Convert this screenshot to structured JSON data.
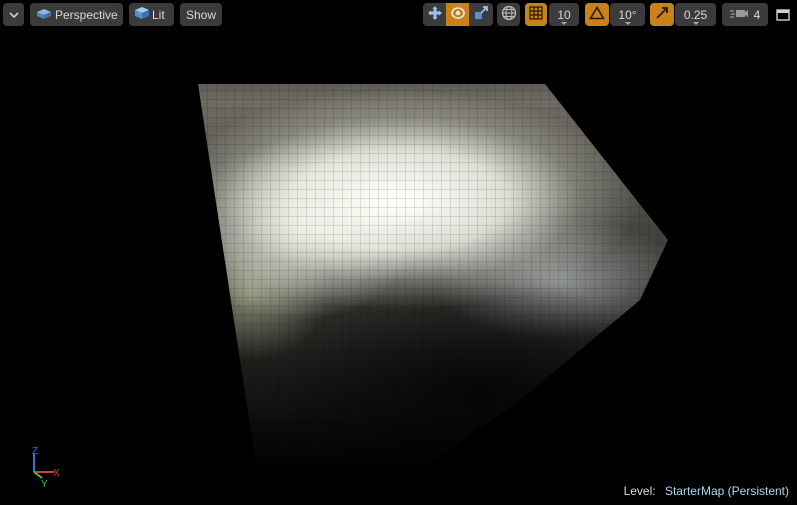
{
  "toolbar": {
    "viewport_menu_icon": "chevron-down-icon",
    "view_mode": {
      "label": "Perspective",
      "icon": "perspective-cube-icon"
    },
    "lighting_mode": {
      "label": "Lit",
      "icon": "lit-sphere-icon"
    },
    "show_label": "Show",
    "transform_tools": [
      {
        "name": "translate",
        "icon": "move-arrows-icon",
        "active": false
      },
      {
        "name": "rotate",
        "icon": "rotate-icon",
        "active": true
      },
      {
        "name": "scale",
        "icon": "scale-icon",
        "active": false
      }
    ],
    "coordinate_space_icon": "globe-icon",
    "grid_snap": {
      "icon": "grid-icon",
      "value": "10",
      "enabled": true
    },
    "rotation_snap": {
      "icon": "angle-icon",
      "value": "10°",
      "enabled": true
    },
    "scale_snap": {
      "icon": "scale-arrow-icon",
      "value": "0.25",
      "enabled": true
    },
    "camera_speed": {
      "icon": "camera-speed-icon",
      "value": "4"
    },
    "maximize_icon": "maximize-icon"
  },
  "axis_gizmo": {
    "x": "X",
    "y": "Y",
    "z": "Z"
  },
  "status": {
    "level_label": "Level:",
    "level_name": "StarterMap (Persistent)"
  },
  "colors": {
    "accent_orange": "#c8821a",
    "button_bg": "#3b3b3b",
    "level_name": "#a9d8f2",
    "axis_x": "#e03a3a",
    "axis_y": "#3ac83a",
    "axis_z": "#3a6ae0"
  }
}
